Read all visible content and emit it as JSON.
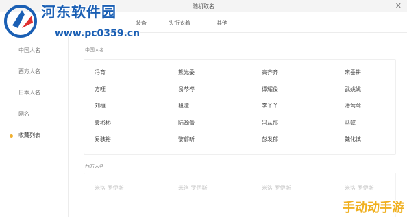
{
  "window": {
    "title": "随机取名",
    "close_glyph": "✕"
  },
  "tabs": [
    {
      "label": "装备"
    },
    {
      "label": "头衔衣着"
    },
    {
      "label": "其他"
    }
  ],
  "sidebar": {
    "items": [
      {
        "label": "中国人名"
      },
      {
        "label": "西方人名"
      },
      {
        "label": "日本人名"
      },
      {
        "label": "网名"
      },
      {
        "label": "收藏列表",
        "active": true
      }
    ],
    "active_dot_color": "#f0b030"
  },
  "sections": {
    "chinese": {
      "label": "中国人名",
      "names": [
        "冯育",
        "熊光委",
        "高齐齐",
        "宋垂耕",
        "方旺",
        "易芩岑",
        "谭耀俊",
        "武姚姚",
        "刘桓",
        "段潼",
        "李丫丫",
        "潘莺莺",
        "袁彬彬",
        "陆瀚蕾",
        "冯从那",
        "马懿",
        "易骇裕",
        "黎郭昕",
        "彭发郁",
        "魏化慎"
      ]
    },
    "western": {
      "label": "西方人名",
      "names": [
        "米洛 罗伊斯",
        "米洛 罗伊斯",
        "米洛 罗伊斯",
        "米洛 罗伊斯"
      ]
    }
  },
  "watermarks": {
    "site_title": "河东软件园",
    "site_url": "www.pc0359.cn",
    "bottom": "手动动手游",
    "brand_color": "#1a5fb4",
    "bottom_color": "#f0b020"
  }
}
